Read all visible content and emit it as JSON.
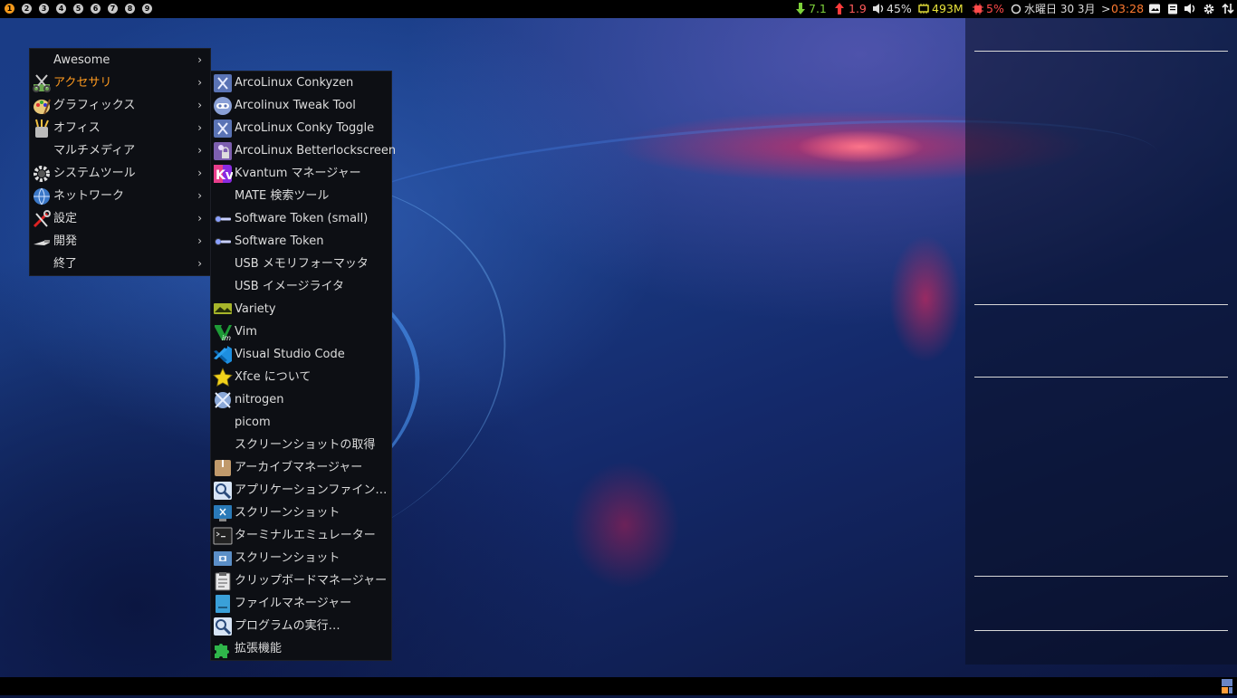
{
  "top_bar": {
    "tags": [
      "1",
      "2",
      "3",
      "4",
      "5",
      "6",
      "7",
      "8",
      "9"
    ],
    "active_tag": "1",
    "net_down": "7.1",
    "net_up": "1.9",
    "volume": "45%",
    "memory": "493M",
    "cpu": "5%",
    "date": "水曜日 30 3月",
    "date_separator": ">",
    "time": "03:28",
    "colors": {
      "accent": "#f59a1c",
      "down": "#7dd03a",
      "up": "#ff3b3b",
      "memory": "#e8e23a",
      "cpu": "#ff4a4a",
      "time": "#ff7a30"
    }
  },
  "main_menu": {
    "items": [
      {
        "label": "Awesome",
        "icon": "none",
        "submenu": true
      },
      {
        "label": "アクセサリ",
        "icon": "accessories-icon",
        "submenu": true,
        "selected": true
      },
      {
        "label": "グラフィックス",
        "icon": "graphics-palette-icon",
        "submenu": true
      },
      {
        "label": "オフィス",
        "icon": "office-icon",
        "submenu": true
      },
      {
        "label": "マルチメディア",
        "icon": "none",
        "submenu": true
      },
      {
        "label": "システムツール",
        "icon": "gear-icon",
        "submenu": true
      },
      {
        "label": "ネットワーク",
        "icon": "globe-icon",
        "submenu": true
      },
      {
        "label": "設定",
        "icon": "settings-tools-icon",
        "submenu": true
      },
      {
        "label": "開発",
        "icon": "development-trowel-icon",
        "submenu": true
      },
      {
        "label": "終了",
        "icon": "none",
        "submenu": true
      }
    ],
    "arrow": "›"
  },
  "accessories_menu": {
    "items": [
      {
        "label": "ArcoLinux Conkyzen",
        "icon": "arcolinux-conkyzen-icon"
      },
      {
        "label": "Arcolinux Tweak Tool",
        "icon": "tweak-tool-icon"
      },
      {
        "label": "ArcoLinux Conky Toggle",
        "icon": "arcolinux-conky-toggle-icon"
      },
      {
        "label": "ArcoLinux Betterlockscreen",
        "icon": "lockscreen-icon"
      },
      {
        "label": "Kvantum マネージャー",
        "icon": "kvantum-icon"
      },
      {
        "label": "MATE 検索ツール",
        "icon": "none"
      },
      {
        "label": "Software Token (small)",
        "icon": "token-key-icon"
      },
      {
        "label": "Software Token",
        "icon": "token-key-icon"
      },
      {
        "label": "USB メモリフォーマッタ",
        "icon": "none"
      },
      {
        "label": "USB イメージライタ",
        "icon": "none"
      },
      {
        "label": "Variety",
        "icon": "variety-icon"
      },
      {
        "label": "Vim",
        "icon": "vim-icon"
      },
      {
        "label": "Visual Studio Code",
        "icon": "vscode-icon"
      },
      {
        "label": "Xfce について",
        "icon": "xfce-star-icon"
      },
      {
        "label": "nitrogen",
        "icon": "nitrogen-icon"
      },
      {
        "label": "picom",
        "icon": "none"
      },
      {
        "label": "スクリーンショットの取得",
        "icon": "none"
      },
      {
        "label": "アーカイブマネージャー",
        "icon": "archive-icon"
      },
      {
        "label": "アプリケーションファイン…",
        "icon": "app-finder-icon"
      },
      {
        "label": "スクリーンショット",
        "icon": "screenshot-icon"
      },
      {
        "label": "ターミナルエミュレーター",
        "icon": "terminal-icon"
      },
      {
        "label": "スクリーンショット",
        "icon": "screenshot-camera-icon"
      },
      {
        "label": "クリップボードマネージャー",
        "icon": "clipboard-icon"
      },
      {
        "label": "ファイルマネージャー",
        "icon": "file-manager-icon"
      },
      {
        "label": "プログラムの実行…",
        "icon": "run-program-icon"
      },
      {
        "label": "拡張機能",
        "icon": "extensions-puzzle-icon"
      }
    ]
  }
}
